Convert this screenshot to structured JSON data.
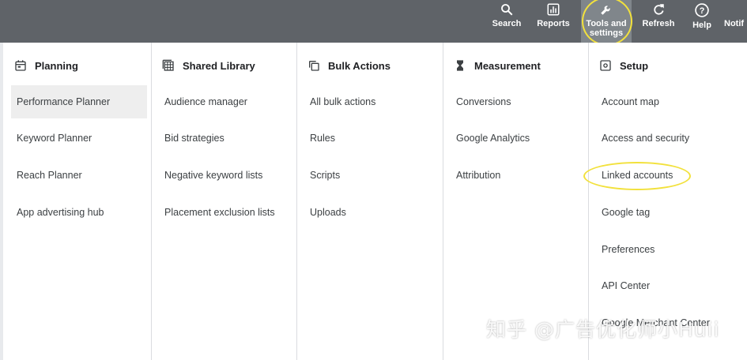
{
  "topbar": {
    "buttons": [
      {
        "label": "Search",
        "icon": "search-icon"
      },
      {
        "label": "Reports",
        "icon": "bar-chart-icon"
      },
      {
        "label_line1": "Tools and",
        "label_line2": "settings",
        "icon": "wrench-icon"
      },
      {
        "label": "Refresh",
        "icon": "refresh-icon"
      },
      {
        "label": "Help",
        "icon": "help-icon"
      },
      {
        "label": "Notif",
        "icon": "bell-icon"
      }
    ],
    "highlight_color": "#f2e13c"
  },
  "columns": [
    {
      "title": "Planning",
      "icon": "calendar-icon",
      "items": [
        "Performance Planner",
        "Keyword Planner",
        "Reach Planner",
        "App advertising hub"
      ]
    },
    {
      "title": "Shared Library",
      "icon": "library-grid-icon",
      "items": [
        "Audience manager",
        "Bid strategies",
        "Negative keyword lists",
        "Placement exclusion lists"
      ]
    },
    {
      "title": "Bulk Actions",
      "icon": "copy-stack-icon",
      "items": [
        "All bulk actions",
        "Rules",
        "Scripts",
        "Uploads"
      ]
    },
    {
      "title": "Measurement",
      "icon": "hourglass-icon",
      "items": [
        "Conversions",
        "Google Analytics",
        "Attribution"
      ]
    },
    {
      "title": "Setup",
      "icon": "gear-icon",
      "items": [
        "Account map",
        "Access and security",
        "Linked accounts",
        "Google tag",
        "Preferences",
        "API Center",
        "Google Merchant Center"
      ]
    }
  ],
  "watermark": "知乎 @广告优化师小Huii"
}
